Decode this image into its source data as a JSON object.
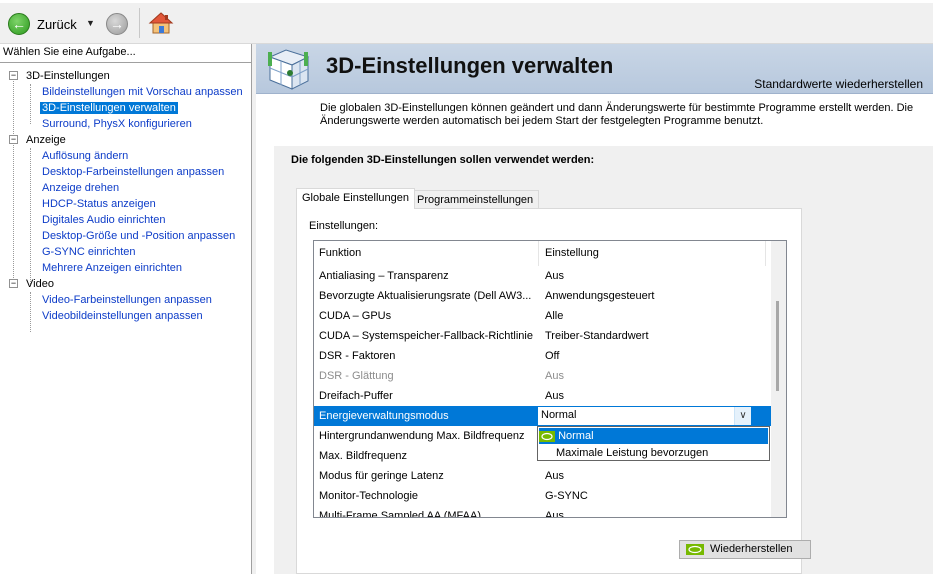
{
  "toolbar": {
    "back_label": "Zurück"
  },
  "sidebar": {
    "header": "Wählen Sie eine Aufgabe...",
    "groups": [
      {
        "label": "3D-Einstellungen",
        "items": [
          "Bildeinstellungen mit Vorschau anpassen",
          "3D-Einstellungen verwalten",
          "Surround, PhysX konfigurieren"
        ]
      },
      {
        "label": "Anzeige",
        "items": [
          "Auflösung ändern",
          "Desktop-Farbeinstellungen anpassen",
          "Anzeige drehen",
          "HDCP-Status anzeigen",
          "Digitales Audio einrichten",
          "Desktop-Größe und -Position anpassen",
          "G-SYNC einrichten",
          "Mehrere Anzeigen einrichten"
        ]
      },
      {
        "label": "Video",
        "items": [
          "Video-Farbeinstellungen anpassen",
          "Videobildeinstellungen anpassen"
        ]
      }
    ],
    "selected_item": "3D-Einstellungen verwalten"
  },
  "main": {
    "title": "3D-Einstellungen verwalten",
    "restore_defaults": "Standardwerte wiederherstellen",
    "intro": "Die globalen 3D-Einstellungen können geändert und dann Änderungswerte für bestimmte Programme erstellt werden. Die Änderungswerte werden automatisch bei jedem Start der festgelegten Programme benutzt.",
    "section_title": "Die folgenden 3D-Einstellungen sollen verwendet werden:",
    "tabs": [
      "Globale Einstellungen",
      "Programmeinstellungen"
    ],
    "settings_label": "Einstellungen:",
    "columns": [
      "Funktion",
      "Einstellung"
    ],
    "rows": [
      {
        "k": "Antialiasing – Transparenz",
        "v": "Aus"
      },
      {
        "k": "Bevorzugte Aktualisierungsrate (Dell AW3...",
        "v": "Anwendungsgesteuert"
      },
      {
        "k": "CUDA – GPUs",
        "v": "Alle"
      },
      {
        "k": "CUDA – Systemspeicher-Fallback-Richtlinie",
        "v": "Treiber-Standardwert"
      },
      {
        "k": "DSR - Faktoren",
        "v": "Off"
      },
      {
        "k": "DSR - Glättung",
        "v": "Aus"
      },
      {
        "k": "Dreifach-Puffer",
        "v": "Aus"
      },
      {
        "k": "Energieverwaltungsmodus",
        "v": "Normal"
      },
      {
        "k": "Hintergrundanwendung Max. Bildfrequenz",
        "v": ""
      },
      {
        "k": "Max. Bildfrequenz",
        "v": ""
      },
      {
        "k": "Modus für geringe Latenz",
        "v": "Aus"
      },
      {
        "k": "Monitor-Technologie",
        "v": "G-SYNC"
      },
      {
        "k": "Multi-Frame Sampled AA (MFAA)",
        "v": "Aus"
      }
    ],
    "dropdown_value": "Normal",
    "dropdown_options": [
      "Normal",
      "Maximale Leistung bevorzugen"
    ],
    "restore_button": "Wiederherstellen"
  },
  "colors": {
    "accent": "#0078d7",
    "link": "#0d3cc8",
    "nvidia_green": "#76b900"
  }
}
